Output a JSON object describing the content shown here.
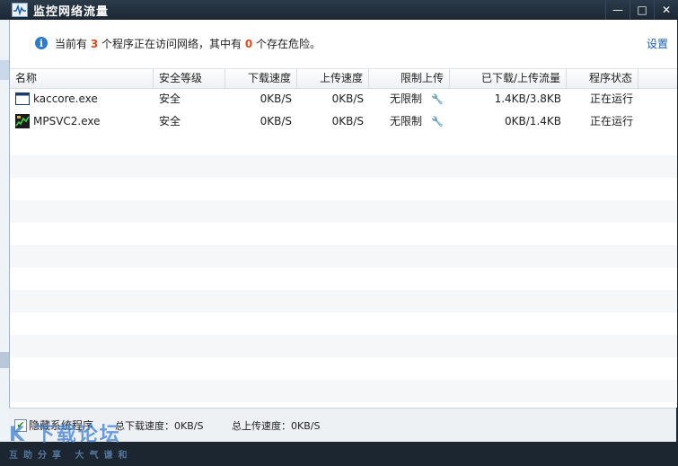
{
  "window": {
    "title": "监控网络流量",
    "controls": [
      "—",
      "□",
      "✕"
    ]
  },
  "info": {
    "prefix": "当前有 ",
    "running_count": "3",
    "middle": " 个程序正在访问网络，其中有 ",
    "danger_count": "0",
    "suffix": " 个存在危险。",
    "settings_label": "设置"
  },
  "table": {
    "headers": [
      "名称",
      "安全等级",
      "下载速度",
      "上传速度",
      "限制上传",
      "已下载/上传流量",
      "程序状态"
    ],
    "rows": [
      {
        "name": "kaccore.exe",
        "security": "安全",
        "download": "0KB/S",
        "upload": "0KB/S",
        "limit": "无限制",
        "traffic": "1.4KB/3.8KB",
        "status": "正在运行",
        "icon": "window-app-icon"
      },
      {
        "name": "MPSVC2.exe",
        "security": "安全",
        "download": "0KB/S",
        "upload": "0KB/S",
        "limit": "无限制",
        "traffic": "0KB/1.4KB",
        "status": "正在运行",
        "icon": "chart-app-icon"
      }
    ]
  },
  "footer": {
    "hide_system_label": "隐藏系统程序",
    "hide_system_checked": true,
    "total_download": "总下载速度：0KB/S",
    "total_upload": "总上传速度：0KB/S"
  },
  "watermark": {
    "main": "K 下载论坛",
    "sub": "互助分享 大气谦和"
  },
  "colors": {
    "accent": "#e0471b",
    "link": "#1a5fb4",
    "titlebar": "#1b2733"
  }
}
